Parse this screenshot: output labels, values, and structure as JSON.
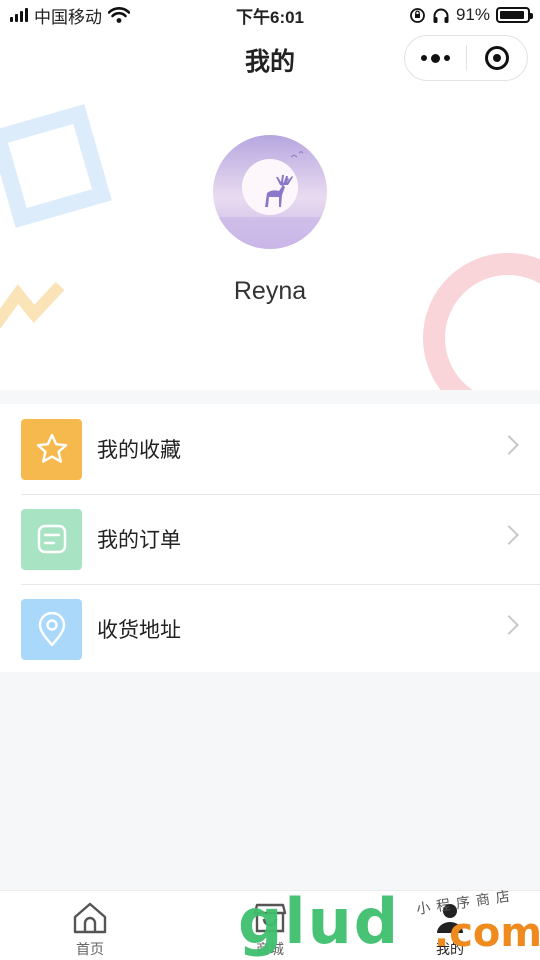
{
  "status_bar": {
    "carrier": "中国移动",
    "time": "下午6:01",
    "battery_percent": "91%",
    "battery_level": 0.91,
    "icons": [
      "signal-icon",
      "wifi-icon",
      "rotation-lock-icon",
      "headphones-icon",
      "battery-icon"
    ]
  },
  "nav": {
    "title": "我的",
    "capsule_icons": [
      "more-dots-icon",
      "close-target-icon"
    ]
  },
  "profile": {
    "username": "Reyna",
    "avatar_icon": "deer-moon-avatar-icon"
  },
  "menu": {
    "items": [
      {
        "label": "我的收藏",
        "icon": "star-icon",
        "color": "#f5b94e"
      },
      {
        "label": "我的订单",
        "icon": "order-icon",
        "color": "#a8e4c3"
      },
      {
        "label": "收货地址",
        "icon": "location-icon",
        "color": "#a9d8fb"
      }
    ]
  },
  "tabs": [
    {
      "label": "首页",
      "icon": "home-icon"
    },
    {
      "label": "商城",
      "icon": "shop-icon"
    },
    {
      "label": "我的",
      "icon": "user-icon",
      "active": true
    }
  ],
  "watermark": {
    "main": "glud",
    "suffix": ".com",
    "sub": "小程序商店"
  },
  "colors": {
    "favorite": "#f5b94e",
    "orders": "#a8e4c3",
    "address": "#a9d8fb",
    "deco_blue": "#dcecfb",
    "deco_pink": "#f9d4d9",
    "deco_yellow": "#fbe3b8"
  }
}
